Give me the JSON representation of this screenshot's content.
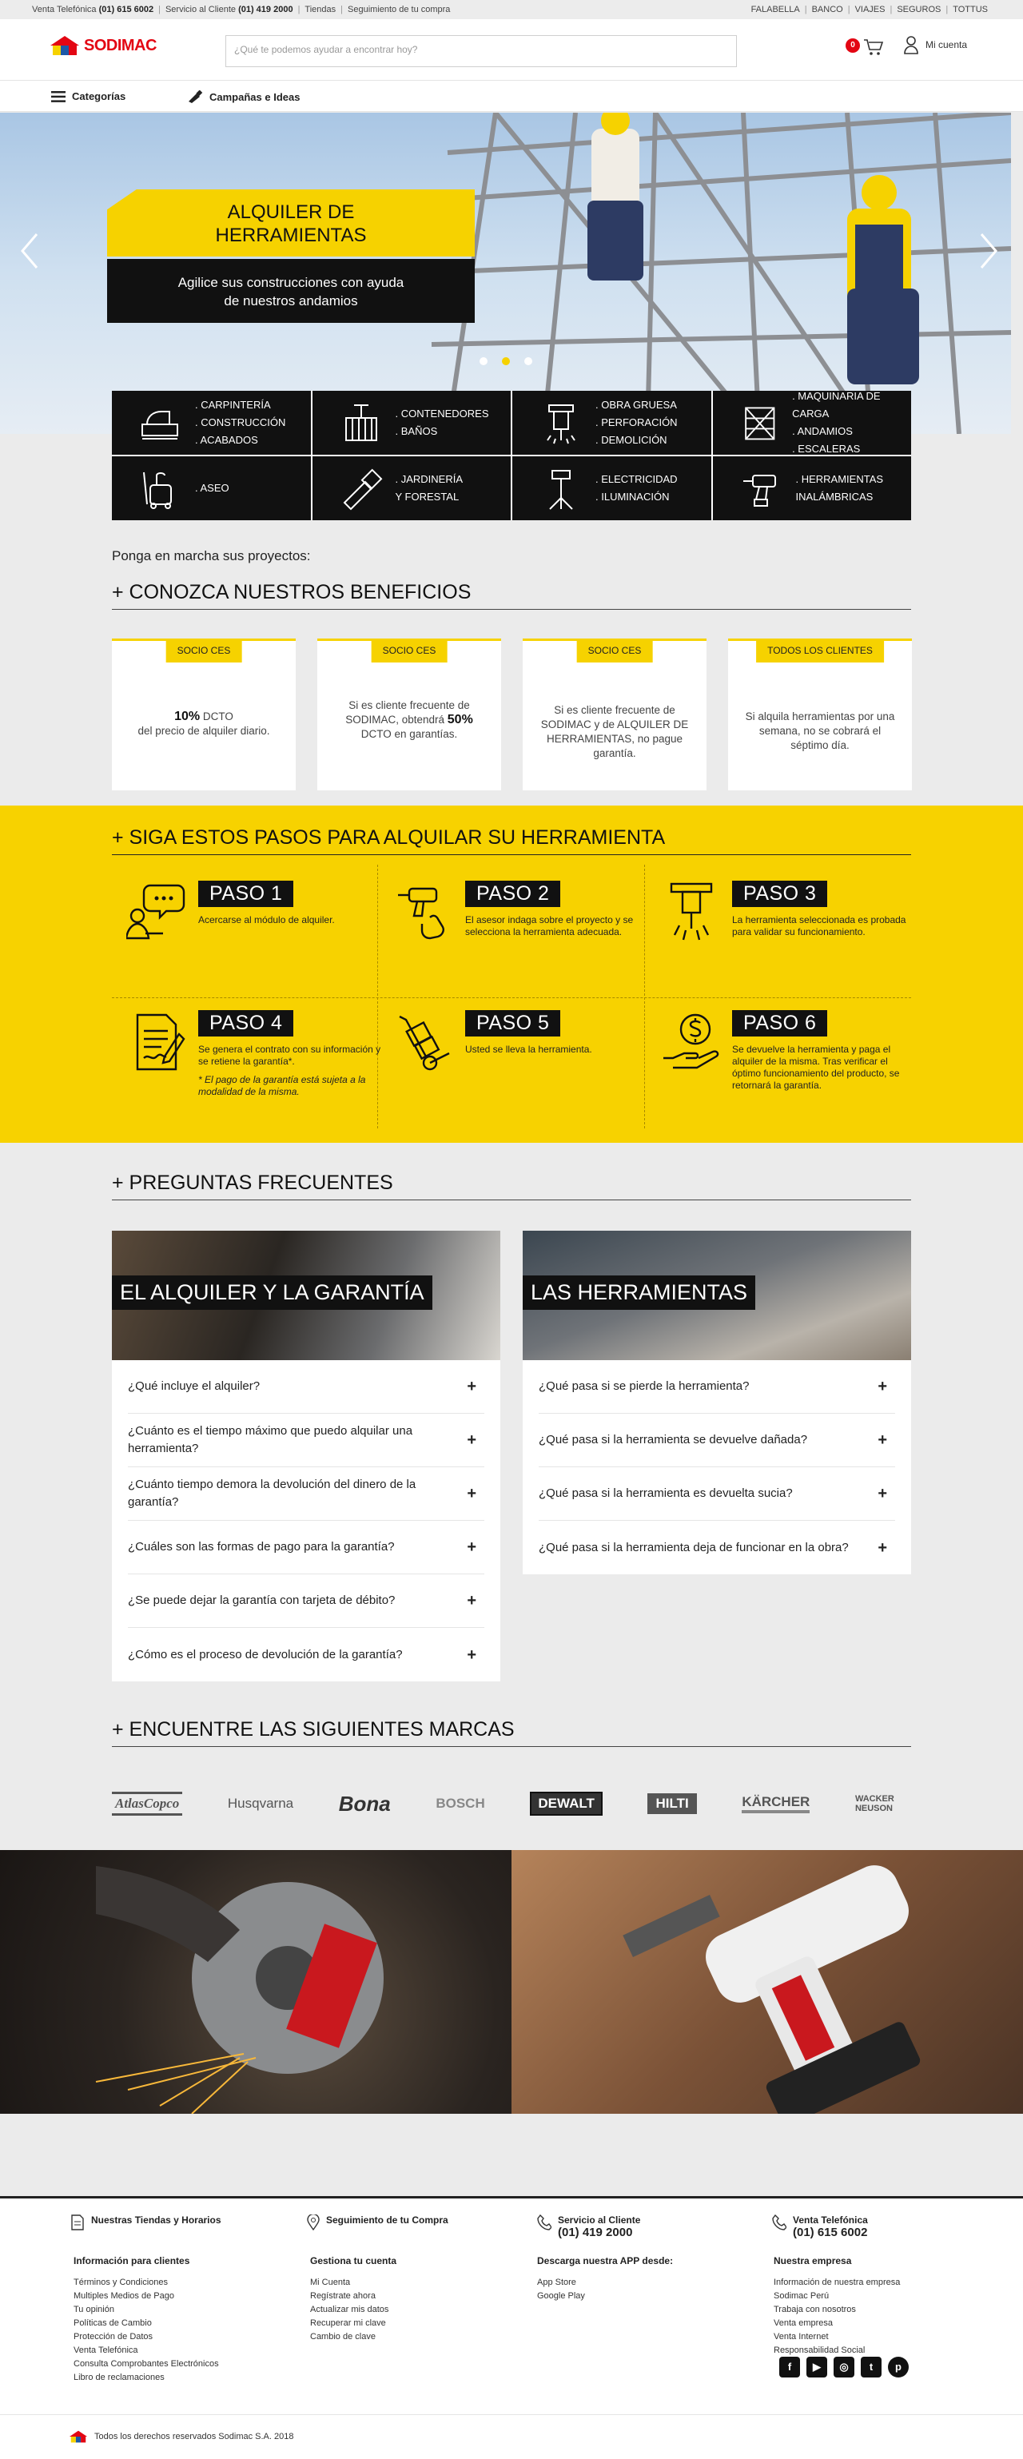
{
  "topbar": {
    "venta_label": "Venta Telefónica",
    "venta_phone": "(01) 615 6002",
    "servicio_label": "Servicio al Cliente",
    "servicio_phone": "(01) 419 2000",
    "tiendas": "Tiendas",
    "seguimiento": "Seguimiento de tu compra",
    "right_links": [
      "FALABELLA",
      "BANCO",
      "VIAJES",
      "SEGUROS",
      "TOTTUS"
    ]
  },
  "header": {
    "logo": "SODIMAC",
    "search_placeholder": "¿Qué te podemos ayudar a encontrar hoy?",
    "cart_count": "0",
    "account": "Mi cuenta"
  },
  "nav": {
    "categories": "Categorías",
    "campaigns": "Campañas e Ideas"
  },
  "hero": {
    "title_line1": "ALQUILER DE",
    "title_line2": "HERRAMIENTAS",
    "subtitle_line1": "Agilice sus construcciones con ayuda",
    "subtitle_line2": "de nuestros andamios",
    "slides": 3,
    "active_slide": 2
  },
  "categories": [
    {
      "icon": "sander-icon",
      "lines": [
        ". CARPINTERÍA",
        ". CONSTRUCCIÓN",
        ". ACABADOS"
      ]
    },
    {
      "icon": "container-icon",
      "lines": [
        ". CONTENEDORES",
        ". BAÑOS"
      ]
    },
    {
      "icon": "jackhammer-icon",
      "lines": [
        ". OBRA GRUESA",
        ". PERFORACIÓN",
        ". DEMOLICIÓN"
      ]
    },
    {
      "icon": "scaffold-icon",
      "lines": [
        ". MAQUINARIA DE CARGA",
        ". ANDAMIOS",
        ". ESCALERAS"
      ]
    },
    {
      "icon": "vacuum-icon",
      "lines": [
        ". ASEO"
      ]
    },
    {
      "icon": "chainsaw-icon",
      "lines": [
        ". JARDINERÍA",
        "Y FORESTAL"
      ]
    },
    {
      "icon": "light-tower-icon",
      "lines": [
        ". ELECTRICIDAD",
        ". ILUMINACIÓN"
      ]
    },
    {
      "icon": "drill-icon",
      "lines": [
        ". HERRAMIENTAS",
        "INALÁMBRICAS"
      ]
    }
  ],
  "intro": "Ponga en marcha sus proyectos:",
  "benefits": {
    "title": "+ CONOZCA NUESTROS BENEFICIOS",
    "items": [
      {
        "tag": "SOCIO CES",
        "strong": "10%",
        "pre": "",
        "after": " DCTO",
        "line2": "del precio de alquiler diario."
      },
      {
        "tag": "SOCIO CES",
        "pre": "Si es cliente frecuente de SODIMAC, obtendrá ",
        "strong": "50%",
        "after": " DCTO",
        "line2": "en garantías."
      },
      {
        "tag": "SOCIO CES",
        "pre": "Si es cliente frecuente de SODIMAC y de ALQUILER DE HERRAMIENTAS, no pague garantía.",
        "strong": "",
        "after": "",
        "line2": ""
      },
      {
        "tag": "TODOS LOS CLIENTES",
        "pre": "Si alquila herramientas por una semana, no se cobrará el séptimo día.",
        "strong": "",
        "after": "",
        "line2": ""
      }
    ]
  },
  "steps": {
    "title": "+ SIGA ESTOS PASOS PARA ALQUILAR SU HERRAMIENTA",
    "items": [
      {
        "badge": "PASO 1",
        "icon": "chat-person-icon",
        "text": "Acercarse al módulo de alquiler.",
        "note": ""
      },
      {
        "badge": "PASO 2",
        "icon": "drill-hand-icon",
        "text": "El asesor indaga sobre el proyecto y se selecciona la herramienta adecuada.",
        "note": ""
      },
      {
        "badge": "PASO 3",
        "icon": "jackhammer-icon",
        "text": "La herramienta seleccionada es probada para validar su funcionamiento.",
        "note": ""
      },
      {
        "badge": "PASO 4",
        "icon": "contract-icon",
        "text": "Se genera el contrato con su información y se retiene la garantía*.",
        "note": "* El pago de la garantía está sujeta a la modalidad de la misma."
      },
      {
        "badge": "PASO 5",
        "icon": "hand-truck-icon",
        "text": "Usted se lleva la herramienta.",
        "note": ""
      },
      {
        "badge": "PASO 6",
        "icon": "money-hand-icon",
        "text": "Se devuelve la herramienta y paga el alquiler de la misma. Tras verificar el óptimo funcionamiento del producto, se retornará la garantía.",
        "note": ""
      }
    ]
  },
  "faq": {
    "title": "+ PREGUNTAS FRECUENTES",
    "left": {
      "title": "EL ALQUILER Y LA GARANTÍA",
      "items": [
        "¿Qué incluye el alquiler?",
        "¿Cuánto es el tiempo máximo que puedo alquilar una herramienta?",
        "¿Cuánto tiempo demora la devolución del dinero de la garantía?",
        "¿Cuáles son las formas de pago para la garantía?",
        "¿Se puede dejar la garantía con tarjeta de débito?",
        "¿Cómo es el proceso de devolución de la garantía?"
      ]
    },
    "right": {
      "title": "LAS HERRAMIENTAS",
      "items": [
        "¿Qué pasa si se pierde la herramienta?",
        "¿Qué pasa si la herramienta se devuelve dañada?",
        "¿Qué pasa si la herramienta es devuelta sucia?",
        "¿Qué pasa si la herramienta deja de funcionar en la obra?"
      ]
    }
  },
  "brands": {
    "title": "+ ENCUENTRE LAS SIGUIENTES MARCAS",
    "items": [
      "AtlasCopco",
      "Husqvarna",
      "Bona",
      "BOSCH",
      "DEWALT",
      "HILTI",
      "KÄRCHER",
      "WACKER NEUSON"
    ]
  },
  "footer": {
    "top": [
      {
        "icon": "document-icon",
        "label": "Nuestras Tiendas y Horarios",
        "sub": ""
      },
      {
        "icon": "location-pin-icon",
        "label": "Seguimiento de tu Compra",
        "sub": ""
      },
      {
        "icon": "phone-icon",
        "label": "Servicio al Cliente",
        "sub": "(01) 419 2000"
      },
      {
        "icon": "phone-icon",
        "label": "Venta Telefónica",
        "sub": "(01) 615 6002"
      }
    ],
    "cols": [
      {
        "title": "Información para clientes",
        "links": [
          "Términos y Condiciones",
          "Multiples Medios de Pago",
          "Tu opinión",
          "Políticas de Cambio",
          "Protección de Datos",
          "Venta Telefónica",
          "Consulta Comprobantes Electrónicos",
          "Libro de reclamaciones"
        ]
      },
      {
        "title": "Gestiona tu cuenta",
        "links": [
          "Mi Cuenta",
          "Regístrate ahora",
          "Actualizar mis datos",
          "Recuperar mi clave",
          "Cambio de clave"
        ]
      },
      {
        "title": "Descarga nuestra APP desde:",
        "links": [
          "App Store",
          "Google Play"
        ]
      },
      {
        "title": "Nuestra empresa",
        "links": [
          "Información de nuestra empresa",
          "Sodimac Perú",
          "Trabaja con nosotros",
          "Venta empresa",
          "Venta Internet",
          "Responsabilidad Social"
        ]
      }
    ],
    "socials": [
      {
        "icon": "facebook-icon",
        "glyph": "f"
      },
      {
        "icon": "youtube-icon",
        "glyph": "▶"
      },
      {
        "icon": "instagram-icon",
        "glyph": "◎"
      },
      {
        "icon": "twitter-icon",
        "glyph": "t"
      },
      {
        "icon": "pinterest-icon",
        "glyph": "p"
      }
    ],
    "copyright": "Todos los derechos reservados Sodimac S.A. 2018"
  },
  "colors": {
    "brand_red": "#e30613",
    "accent_yellow": "#f7d200",
    "dark": "#111111"
  }
}
